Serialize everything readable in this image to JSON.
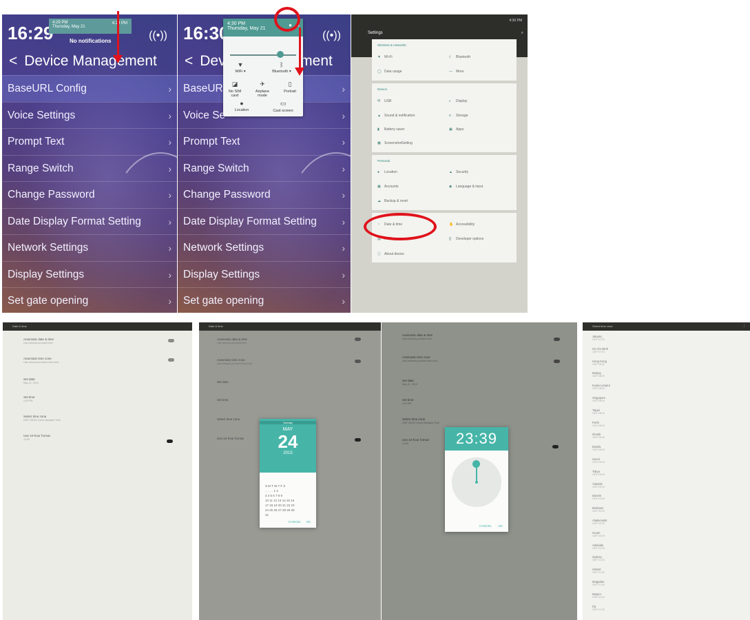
{
  "panel_a": {
    "time": "16:29",
    "title": "Device Management",
    "notification": {
      "time": "4:29 PM",
      "date": "Thursday, May 21",
      "clock": "4:29 PM",
      "message": "No notifications"
    },
    "menu": [
      {
        "label": "BaseURL Config"
      },
      {
        "label": "Voice Settings"
      },
      {
        "label": "Prompt Text"
      },
      {
        "label": "Range Switch"
      },
      {
        "label": "Change Password"
      },
      {
        "label": "Date Display Format Setting"
      },
      {
        "label": "Network Settings"
      },
      {
        "label": "Display Settings"
      },
      {
        "label": "Set gate opening"
      }
    ]
  },
  "panel_b": {
    "time": "16:30",
    "title": "Device Management",
    "quick_settings": {
      "time": "4:30 PM",
      "date": "Thursday, May 21",
      "tiles": [
        {
          "label": "WiFi ▾",
          "icon": "wifi-icon"
        },
        {
          "label": "Bluetooth ▾",
          "icon": "bluetooth-icon"
        },
        {
          "label": "No SIM card",
          "icon": "signal-icon"
        },
        {
          "label": "Airplane mode",
          "icon": "airplane-icon"
        },
        {
          "label": "Portrait",
          "icon": "portrait-icon"
        },
        {
          "label": "Location",
          "icon": "location-icon"
        },
        {
          "label": "Cast screen",
          "icon": "cast-icon"
        }
      ]
    },
    "menu": [
      {
        "label": "BaseURL Config"
      },
      {
        "label": "Voice Se"
      },
      {
        "label": "Prompt Text"
      },
      {
        "label": "Range Switch"
      },
      {
        "label": "Change Password"
      },
      {
        "label": "Date Display Format Setting"
      },
      {
        "label": "Network Settings"
      },
      {
        "label": "Display Settings"
      },
      {
        "label": "Set gate opening"
      }
    ]
  },
  "settings": {
    "title": "Settings",
    "status": "4:30 PM",
    "sections": [
      {
        "header": "Wireless & networks",
        "items": [
          "Wi-Fi",
          "Bluetooth",
          "Data usage",
          "More"
        ]
      },
      {
        "header": "Device",
        "items": [
          "USB",
          "Display",
          "Sound & notification",
          "Storage",
          "Battery saver",
          "Apps",
          "ScreenshotSetting"
        ]
      },
      {
        "header": "Personal",
        "items": [
          "Location",
          "Security",
          "Accounts",
          "Language & input",
          "Backup & reset"
        ]
      },
      {
        "header": "System",
        "items": [
          "Date & time",
          "Accessibility",
          "Printing",
          "Developer options",
          "About device"
        ]
      }
    ]
  },
  "date_time": {
    "title": "Date & time",
    "entries": [
      {
        "label": "Automatic date & time",
        "sub": "Use network-provided time"
      },
      {
        "label": "Automatic time zone",
        "sub": "Use network-provided time zone"
      },
      {
        "label": "Set date",
        "sub": "May 21, 2015"
      },
      {
        "label": "Set time",
        "sub": "4:30 PM"
      },
      {
        "label": "Select time zone",
        "sub": "GMT+08:00 China Standard Time"
      },
      {
        "label": "Use 24-hour format",
        "sub": "13:00"
      }
    ]
  },
  "date_picker": {
    "year": "2015",
    "month": "MAY",
    "day": "24",
    "weekday": "Sunday",
    "calendar_rows": [
      "S M T W T F S",
      ". . . . . 1 2",
      "3 4 5 6 7 8 9",
      "10 11 12 13 14 15 16",
      "17 18 19 20 21 22 23",
      "24 25 26 27 28 29 30",
      "31"
    ],
    "cancel": "CANCEL",
    "ok": "OK"
  },
  "time_picker": {
    "time": "23:39",
    "cancel": "CANCEL",
    "ok": "OK"
  },
  "time_zone": {
    "title": "Select time zone",
    "zones": [
      {
        "name": "Jakarta",
        "sub": "GMT+07:00"
      },
      {
        "name": "Ho Chi Minh",
        "sub": "GMT+07:00"
      },
      {
        "name": "Hong Kong",
        "sub": "GMT+08:00"
      },
      {
        "name": "Beijing",
        "sub": "GMT+08:00"
      },
      {
        "name": "Kuala Lumpur",
        "sub": "GMT+08:00"
      },
      {
        "name": "Singapore",
        "sub": "GMT+08:00"
      },
      {
        "name": "Taipei",
        "sub": "GMT+08:00"
      },
      {
        "name": "Perth",
        "sub": "GMT+08:00"
      },
      {
        "name": "Irkutsk",
        "sub": "GMT+08:00"
      },
      {
        "name": "Manila",
        "sub": "GMT+08:00"
      },
      {
        "name": "Seoul",
        "sub": "GMT+09:00"
      },
      {
        "name": "Tokyo",
        "sub": "GMT+09:00"
      },
      {
        "name": "Yakutsk",
        "sub": "GMT+09:00"
      },
      {
        "name": "Darwin",
        "sub": "GMT+09:30"
      },
      {
        "name": "Brisbane",
        "sub": "GMT+10:00"
      },
      {
        "name": "Vladivostok",
        "sub": "GMT+10:00"
      },
      {
        "name": "Guam",
        "sub": "GMT+10:00"
      },
      {
        "name": "Adelaide",
        "sub": "GMT+10:30"
      },
      {
        "name": "Sydney",
        "sub": "GMT+11:00"
      },
      {
        "name": "Hobart",
        "sub": "GMT+11:00"
      },
      {
        "name": "Magadan",
        "sub": "GMT+11:00"
      },
      {
        "name": "Majuro",
        "sub": "GMT+12:00"
      },
      {
        "name": "Fiji",
        "sub": "GMT+12:00"
      }
    ]
  },
  "colors": {
    "annotation_red": "#e0121b",
    "android_teal": "#46b5a8",
    "panel_purple": "#4b3f8d"
  }
}
